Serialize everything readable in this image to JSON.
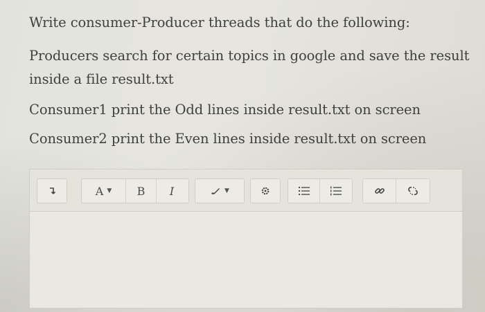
{
  "question": {
    "title": "Write consumer-Producer threads that do the following:",
    "producers_line1": "Producers search for certain topics in google and save the result",
    "producers_line2": "inside a file result.txt",
    "consumer1": "Consumer1 print the Odd lines inside result.txt on screen",
    "consumer2": "Consumer2 print the Even lines inside result.txt on screen"
  },
  "editor": {
    "toolbar": {
      "paragraph_icon": "paragraph-format-icon",
      "font_label": "A",
      "bold_label": "B",
      "italic_label": "I",
      "brush_icon": "paint-brush-icon",
      "settings_icon": "gear-icon",
      "ordered_list_icon": "numbered-list-icon",
      "unordered_list_icon": "bullet-list-icon",
      "link_icon": "link-icon",
      "unlink_icon": "unlink-icon"
    },
    "content": ""
  },
  "colors": {
    "text": "#3f3f3f",
    "toolbar_bg": "#e4e3dc",
    "border": "#cfcfc6"
  }
}
